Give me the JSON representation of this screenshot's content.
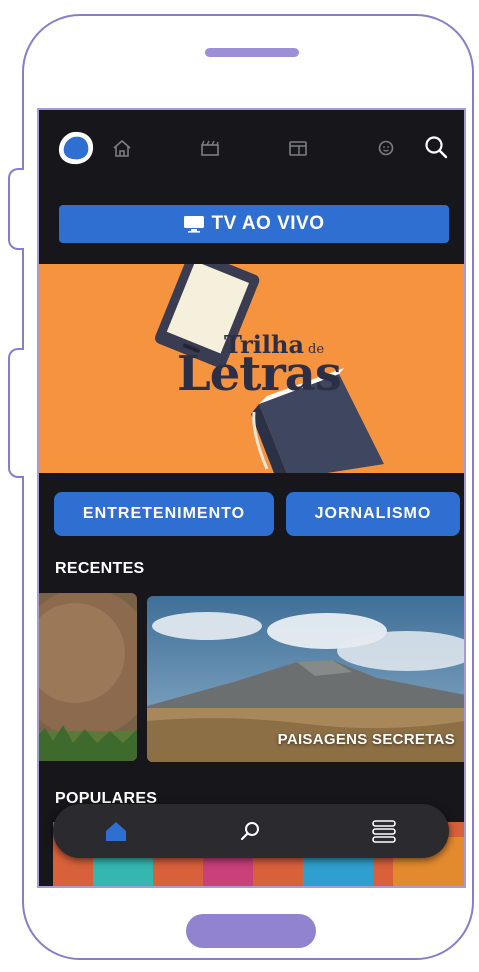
{
  "header": {
    "nav_icons": [
      "logo-icon",
      "home-icon",
      "clapperboard-icon",
      "tv-guide-icon",
      "kids-icon",
      "search-icon"
    ]
  },
  "live_button": {
    "label": "TV AO VIVO",
    "icon": "tv-icon"
  },
  "banner": {
    "title_small": "Trilha",
    "title_de": "de",
    "title_big": "Letras"
  },
  "categories": [
    "ENTRETENIMENTO",
    "JORNALISMO"
  ],
  "sections": {
    "recent_title": "RECENTES",
    "recent_cards": [
      {
        "label": ""
      },
      {
        "label": "PAISAGENS SECRETAS"
      }
    ],
    "popular_title": "POPULARES"
  },
  "bottom_nav": {
    "items": [
      "home-icon",
      "search-icon",
      "menu-icon"
    ]
  },
  "colors": {
    "accent": "#2f6fd1",
    "banner": "#f6933f",
    "background": "#17171b",
    "frame": "#8a7cc9"
  }
}
